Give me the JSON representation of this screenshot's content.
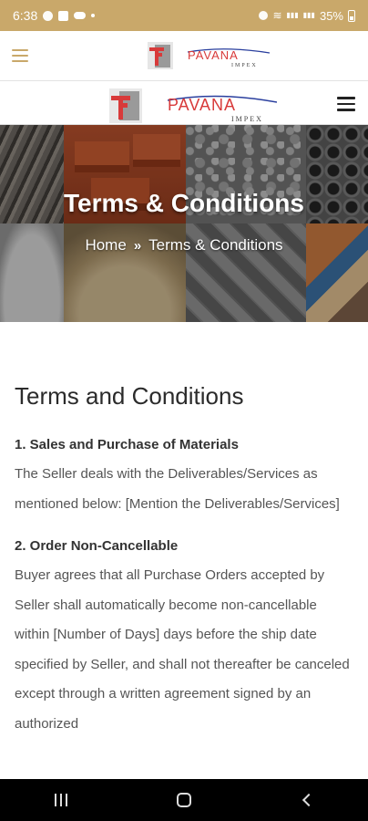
{
  "status_bar": {
    "time": "6:38",
    "net_small": "Vo)\nLTE1",
    "net_small2": "Vo)\nLTE2",
    "battery": "35%"
  },
  "brand": {
    "name": "PAVANA",
    "sub": "IMPEX",
    "red": "#d83a3a",
    "gold": "#c9a86a"
  },
  "hero": {
    "title": "Terms & Conditions",
    "breadcrumb_home": "Home",
    "breadcrumb_sep": "»",
    "breadcrumb_current": "Terms & Conditions"
  },
  "content": {
    "heading": "Terms and Conditions",
    "sections": [
      {
        "title": "1. Sales and Purchase of Materials",
        "body": "The Seller deals with the Deliverables/Services as mentioned below: [Mention the Deliverables/Services]"
      },
      {
        "title": "2. Order Non-Cancellable",
        "body": "Buyer agrees that all Purchase Orders accepted by Seller shall automatically become non-cancellable within [Number of Days] days before the ship date specified by Seller, and shall not thereafter be canceled except through a written agreement signed by an authorized"
      }
    ]
  }
}
